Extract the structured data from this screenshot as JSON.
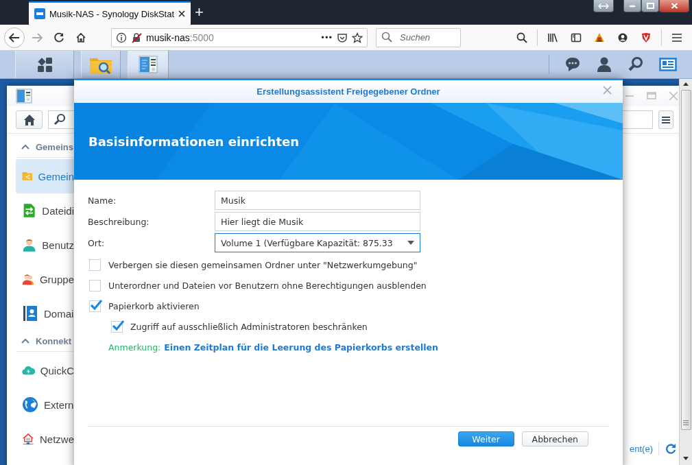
{
  "browser": {
    "tab": {
      "title": "Musik-NAS - Synology DiskStat",
      "selected": true
    },
    "new_tab": "+",
    "address": {
      "host": "musik-nas",
      "port": ":5000"
    },
    "page_actions": "•••",
    "search": {
      "placeholder": "Suchen"
    }
  },
  "taskbar": {
    "apps": [
      {
        "kind": "main-menu",
        "selected": false
      },
      {
        "kind": "file-station",
        "selected": false
      },
      {
        "kind": "control-panel",
        "selected": true
      }
    ]
  },
  "control_panel": {
    "sidebar": [
      {
        "kind": "header",
        "label": "Gemeins",
        "expanded": true
      },
      {
        "kind": "item",
        "label": "Gemein",
        "selected": true
      },
      {
        "kind": "item",
        "label": "Dateidi",
        "selected": false
      },
      {
        "kind": "item",
        "label": "Benutz",
        "selected": false
      },
      {
        "kind": "item",
        "label": "Gruppe",
        "selected": false
      },
      {
        "kind": "item",
        "label": "Domai",
        "selected": false
      },
      {
        "kind": "header",
        "label": "Konnekt",
        "expanded": true
      },
      {
        "kind": "item",
        "label": "QuickC",
        "selected": false
      },
      {
        "kind": "item",
        "label": "Extern",
        "selected": false
      },
      {
        "kind": "item",
        "label": "Netzwe",
        "selected": false
      }
    ],
    "footer_text": "ent(e)"
  },
  "dialog": {
    "title": "Erstellungsassistent Freigegebener Ordner",
    "banner": "Basisinformationen einrichten",
    "fields": [
      {
        "label": "Name:",
        "kind": "text",
        "value": "Musik",
        "focused": false
      },
      {
        "label": "Beschreibung:",
        "kind": "text",
        "value": "Hier liegt die Musik",
        "focused": false
      },
      {
        "label": "Ort:",
        "kind": "select",
        "value": "Volume 1 (Verfügbare Kapazität: 875.33",
        "focused": true
      }
    ],
    "options": [
      {
        "label": "Verbergen sie diesen gemeinsamen Ordner unter \"Netzwerkumgebung\"",
        "checked": false
      },
      {
        "label": "Unterordner und Dateien vor Benutzern ohne Berechtigungen ausblenden",
        "checked": false
      },
      {
        "label": "Papierkorb aktivieren",
        "checked": true,
        "children": [
          {
            "label": "Zugriff auf ausschließlich Administratoren beschränken",
            "checked": true
          }
        ]
      }
    ],
    "note": {
      "label": "Anmerkung:",
      "link": "Einen Zeitplan für die Leerung des Papierkorbs erstellen"
    },
    "buttons": [
      {
        "label": "Weiter",
        "kind": "primary"
      },
      {
        "label": "Abbrechen",
        "kind": "secondary"
      }
    ]
  }
}
